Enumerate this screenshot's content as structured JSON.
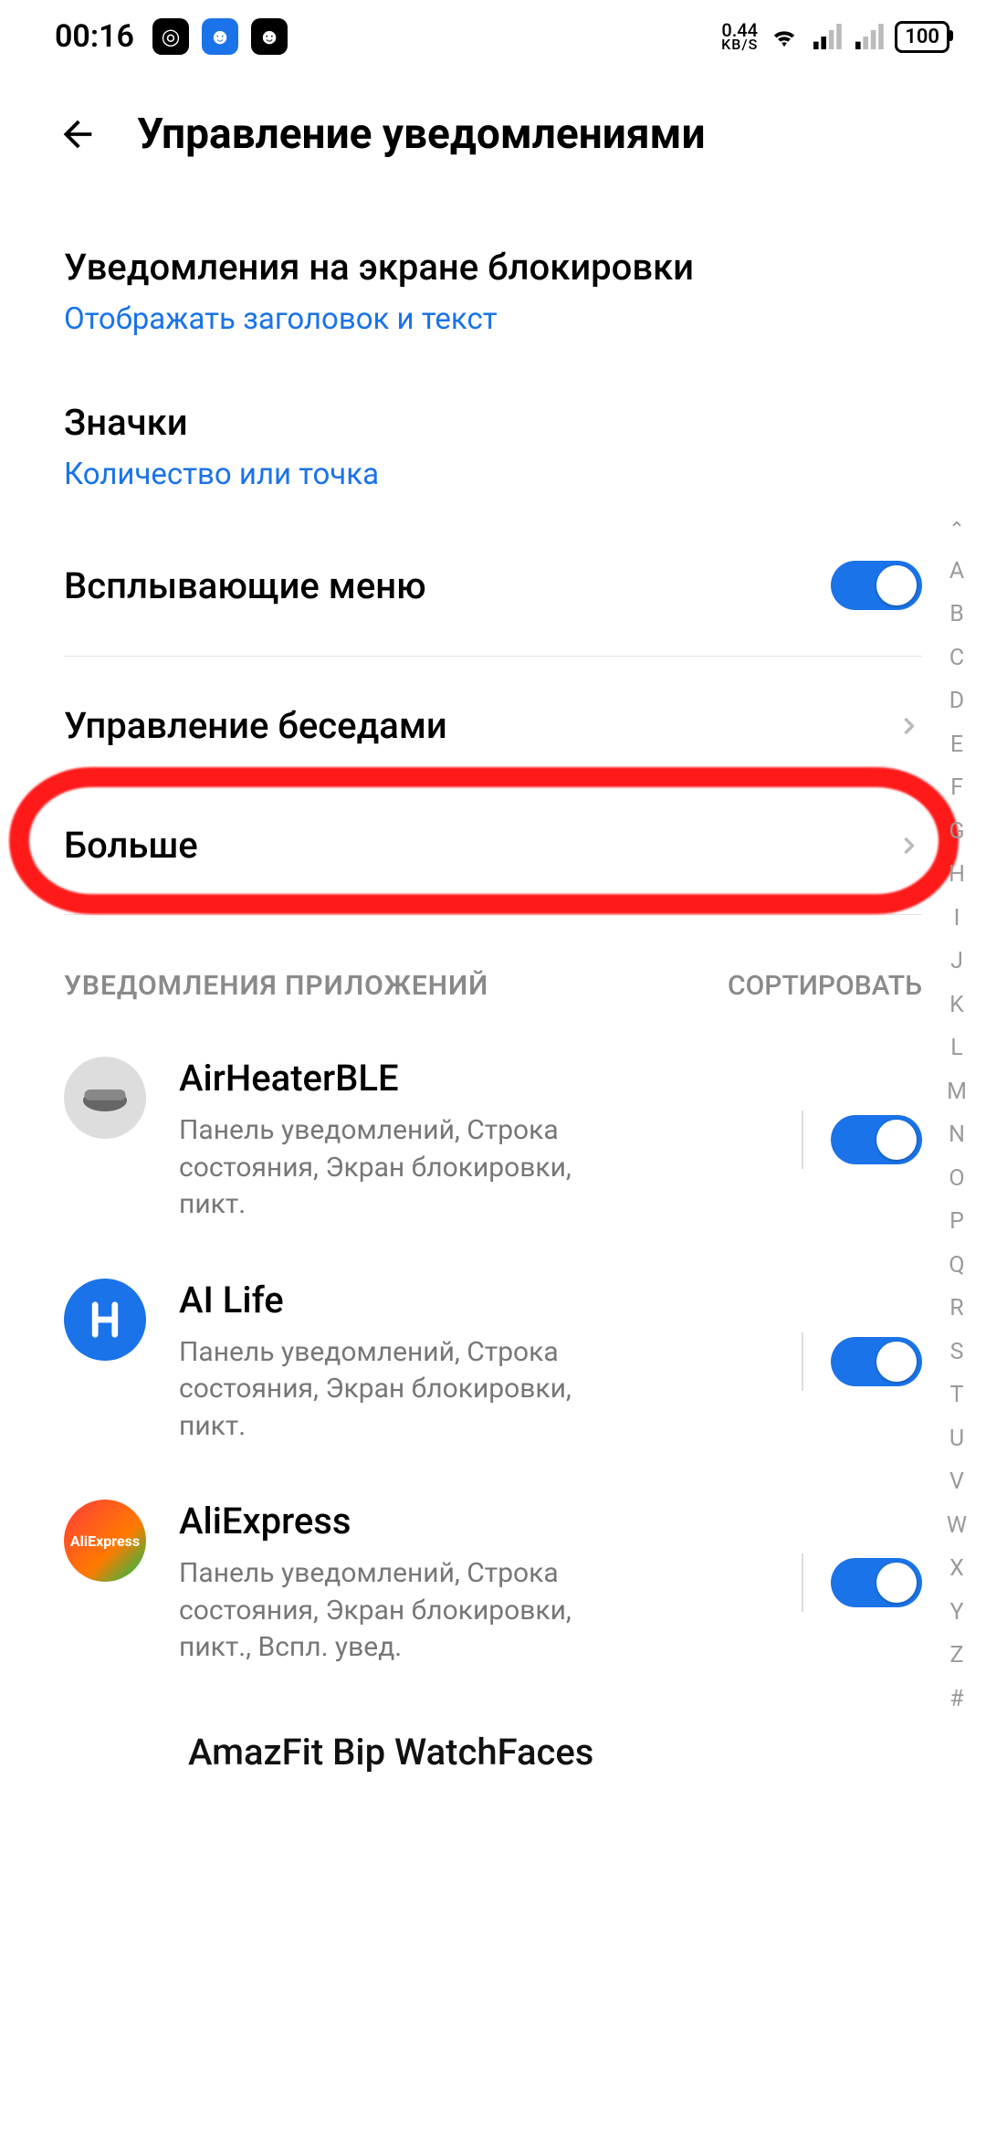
{
  "status": {
    "time": "00:16",
    "net_speed_value": "0.44",
    "net_speed_unit": "KB/S",
    "battery": "100"
  },
  "header": {
    "title": "Управление уведомлениями"
  },
  "rows": {
    "lockscreen": {
      "title": "Уведомления на экране блокировки",
      "sub": "Отображать заголовок и текст"
    },
    "badges": {
      "title": "Значки",
      "sub": "Количество или точка"
    },
    "popup": {
      "title": "Всплывающие меню",
      "on": true
    },
    "conversations": {
      "title": "Управление беседами"
    },
    "more": {
      "title": "Больше"
    }
  },
  "section": {
    "label": "УВЕДОМЛЕНИЯ ПРИЛОЖЕНИЙ",
    "sort": "СОРТИРОВАТЬ"
  },
  "apps": [
    {
      "id": "airheater",
      "name": "AirHeaterBLE",
      "sub": "Панель уведомлений, Строка состояния, Экран блокировки, пикт.",
      "on": true
    },
    {
      "id": "ailife",
      "name": "AI Life",
      "sub": "Панель уведомлений, Строка состояния, Экран блокировки, пикт.",
      "on": true
    },
    {
      "id": "aliexpress",
      "name": "AliExpress",
      "sub": "Панель уведомлений, Строка состояния, Экран блокировки, пикт., Вспл. увед.",
      "on": true
    }
  ],
  "truncated_app": "AmazFit Bip WatchFaces",
  "alpha_index": [
    "A",
    "B",
    "C",
    "D",
    "E",
    "F",
    "G",
    "H",
    "I",
    "J",
    "K",
    "L",
    "M",
    "N",
    "O",
    "P",
    "Q",
    "R",
    "S",
    "T",
    "U",
    "V",
    "W",
    "X",
    "Y",
    "Z",
    "#"
  ]
}
